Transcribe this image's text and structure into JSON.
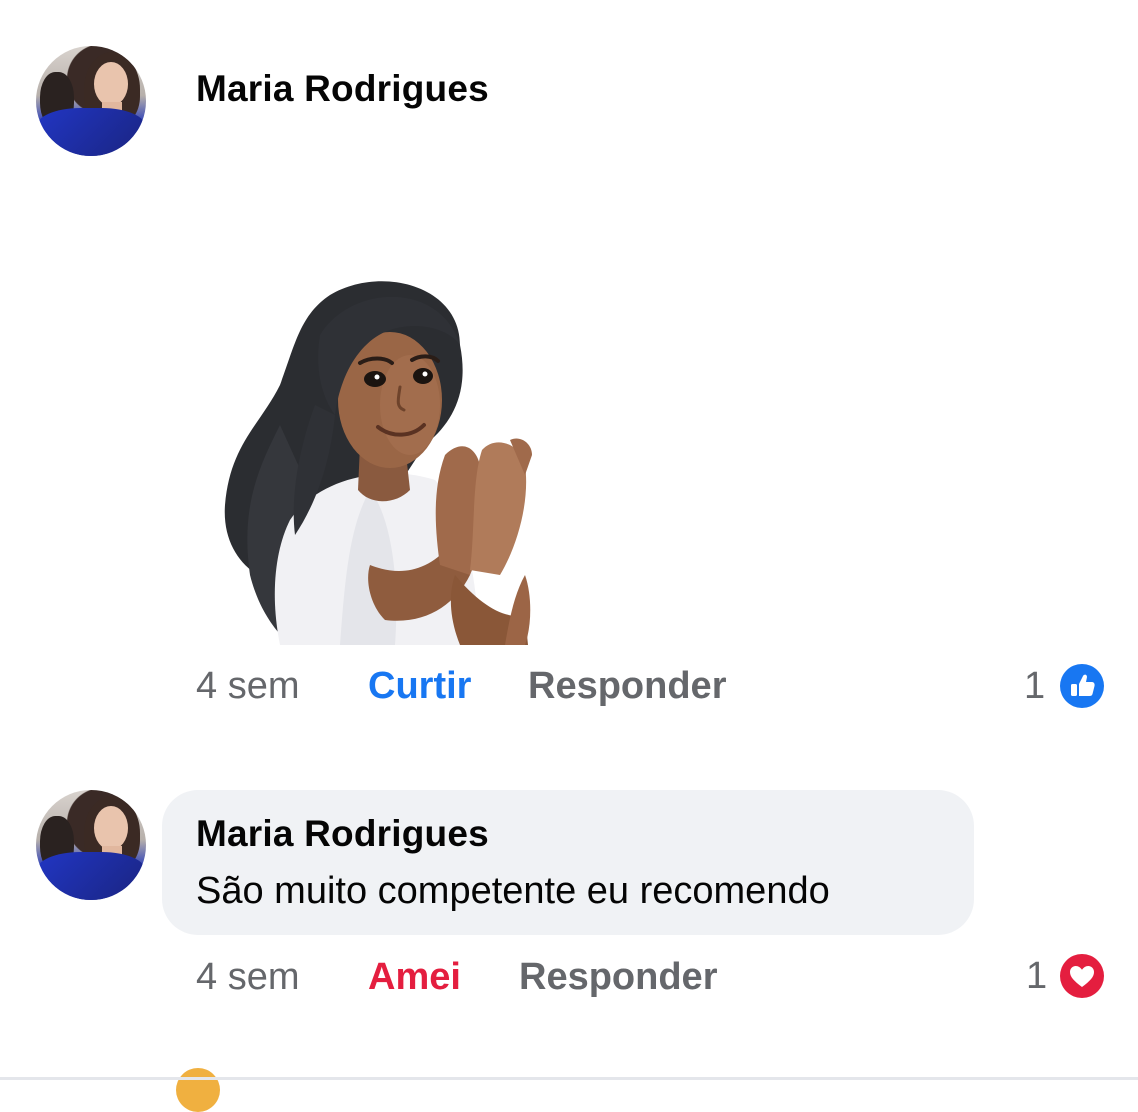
{
  "post_comment": {
    "author": "Maria Rodrigues",
    "time": "4 sem",
    "like_label": "Curtir",
    "reply_label": "Responder",
    "reaction_count": "1",
    "reaction_icon": "like-icon",
    "reaction_color": "#1877f2"
  },
  "reply_comment": {
    "author": "Maria Rodrigues",
    "text": "São muito competente eu recomendo",
    "time": "4 sem",
    "like_label": "Amei",
    "reply_label": "Responder",
    "reaction_count": "1",
    "reaction_icon": "heart-icon",
    "reaction_color": "#e41e3f"
  }
}
